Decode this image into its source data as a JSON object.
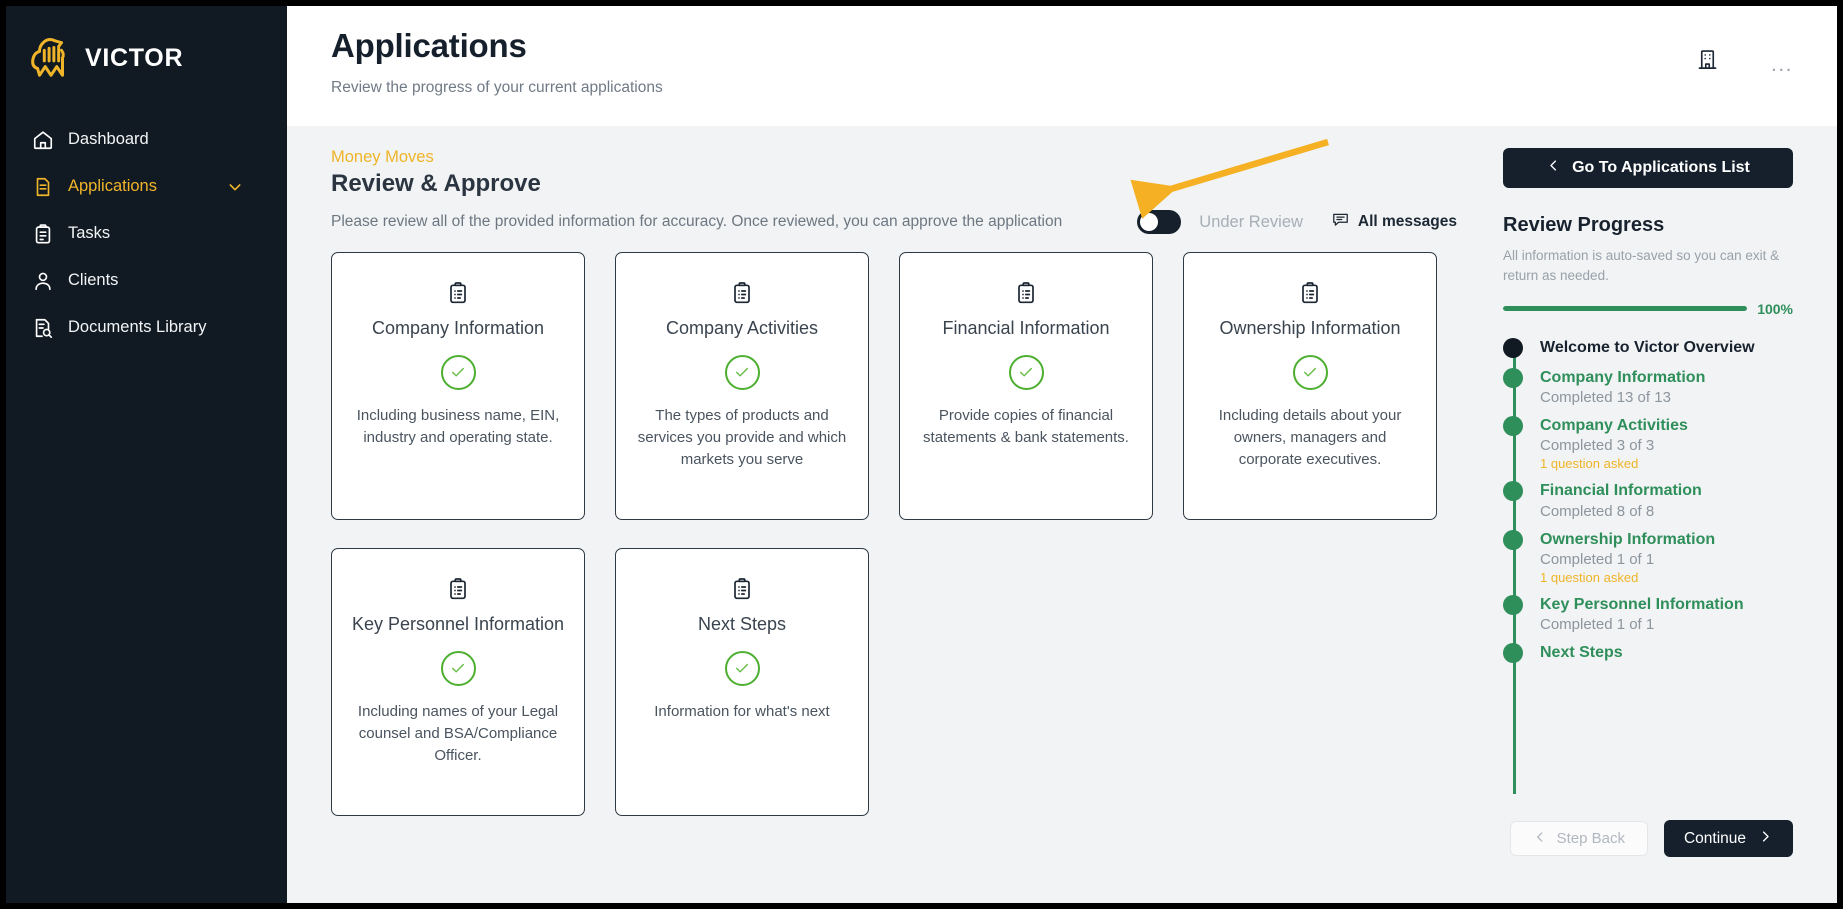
{
  "sidebar": {
    "logo_text": "VICTOR",
    "items": [
      {
        "label": "Dashboard",
        "icon": "home-icon",
        "active": false
      },
      {
        "label": "Applications",
        "icon": "document-icon",
        "active": true,
        "chevron": "chevron-down-icon"
      },
      {
        "label": "Tasks",
        "icon": "clipboard-icon",
        "active": false
      },
      {
        "label": "Clients",
        "icon": "person-icon",
        "active": false
      },
      {
        "label": "Documents Library",
        "icon": "document-search-icon",
        "active": false
      }
    ]
  },
  "header": {
    "title": "Applications",
    "subtitle": "Review the progress of your current applications",
    "building_icon": "building-icon",
    "more_menu": "..."
  },
  "section": {
    "eyebrow": "Money Moves",
    "title": "Review & Approve",
    "description": "Please review all of the provided information for accuracy. Once reviewed, you can approve the application",
    "toggle_state": "off",
    "toggle_label": "Under Review",
    "messages_label": "All messages",
    "messages_icon": "message-bubble-icon"
  },
  "cards": [
    {
      "title": "Company Information",
      "icon": "clipboard-list-icon",
      "status": "complete",
      "description": "Including business name, EIN, industry and operating state."
    },
    {
      "title": "Company Activities",
      "icon": "clipboard-list-icon",
      "status": "complete",
      "description": "The types of products and services you provide and which markets you serve"
    },
    {
      "title": "Financial Information",
      "icon": "clipboard-list-icon",
      "status": "complete",
      "description": "Provide copies of financial statements & bank statements."
    },
    {
      "title": "Ownership Information",
      "icon": "clipboard-list-icon",
      "status": "complete",
      "description": "Including details about your owners, managers and corporate executives."
    },
    {
      "title": "Key Personnel Information",
      "icon": "clipboard-list-icon",
      "status": "complete",
      "description": "Including names of your Legal counsel and BSA/Compliance Officer."
    },
    {
      "title": "Next Steps",
      "icon": "clipboard-list-icon",
      "status": "complete",
      "description": "Information for what's next"
    }
  ],
  "right_panel": {
    "go_to_list_label": "Go To Applications List",
    "progress_title": "Review Progress",
    "progress_sub": "All information is auto-saved so you can exit & return as needed.",
    "progress_percent": "100%",
    "progress_value": 100,
    "timeline": [
      {
        "label": "Welcome to Victor Overview",
        "meta": "",
        "note": "",
        "state": "current"
      },
      {
        "label": "Company Information",
        "meta": "Completed 13 of 13",
        "note": "",
        "state": "done"
      },
      {
        "label": "Company Activities",
        "meta": "Completed 3 of 3",
        "note": "1 question asked",
        "state": "done"
      },
      {
        "label": "Financial Information",
        "meta": "Completed 8 of 8",
        "note": "",
        "state": "done"
      },
      {
        "label": "Ownership Information",
        "meta": "Completed 1 of 1",
        "note": "1 question asked",
        "state": "done"
      },
      {
        "label": "Key Personnel Information",
        "meta": "Completed 1 of 1",
        "note": "",
        "state": "done"
      },
      {
        "label": "Next Steps",
        "meta": "",
        "note": "",
        "state": "done"
      }
    ],
    "step_back_label": "Step Back",
    "continue_label": "Continue"
  },
  "colors": {
    "brand_yellow": "#f0b429",
    "sidebar_dark": "#111a23",
    "green": "#2f8f5b",
    "check_green": "#4caf2f",
    "annotation_arrow": "#f5b123"
  }
}
